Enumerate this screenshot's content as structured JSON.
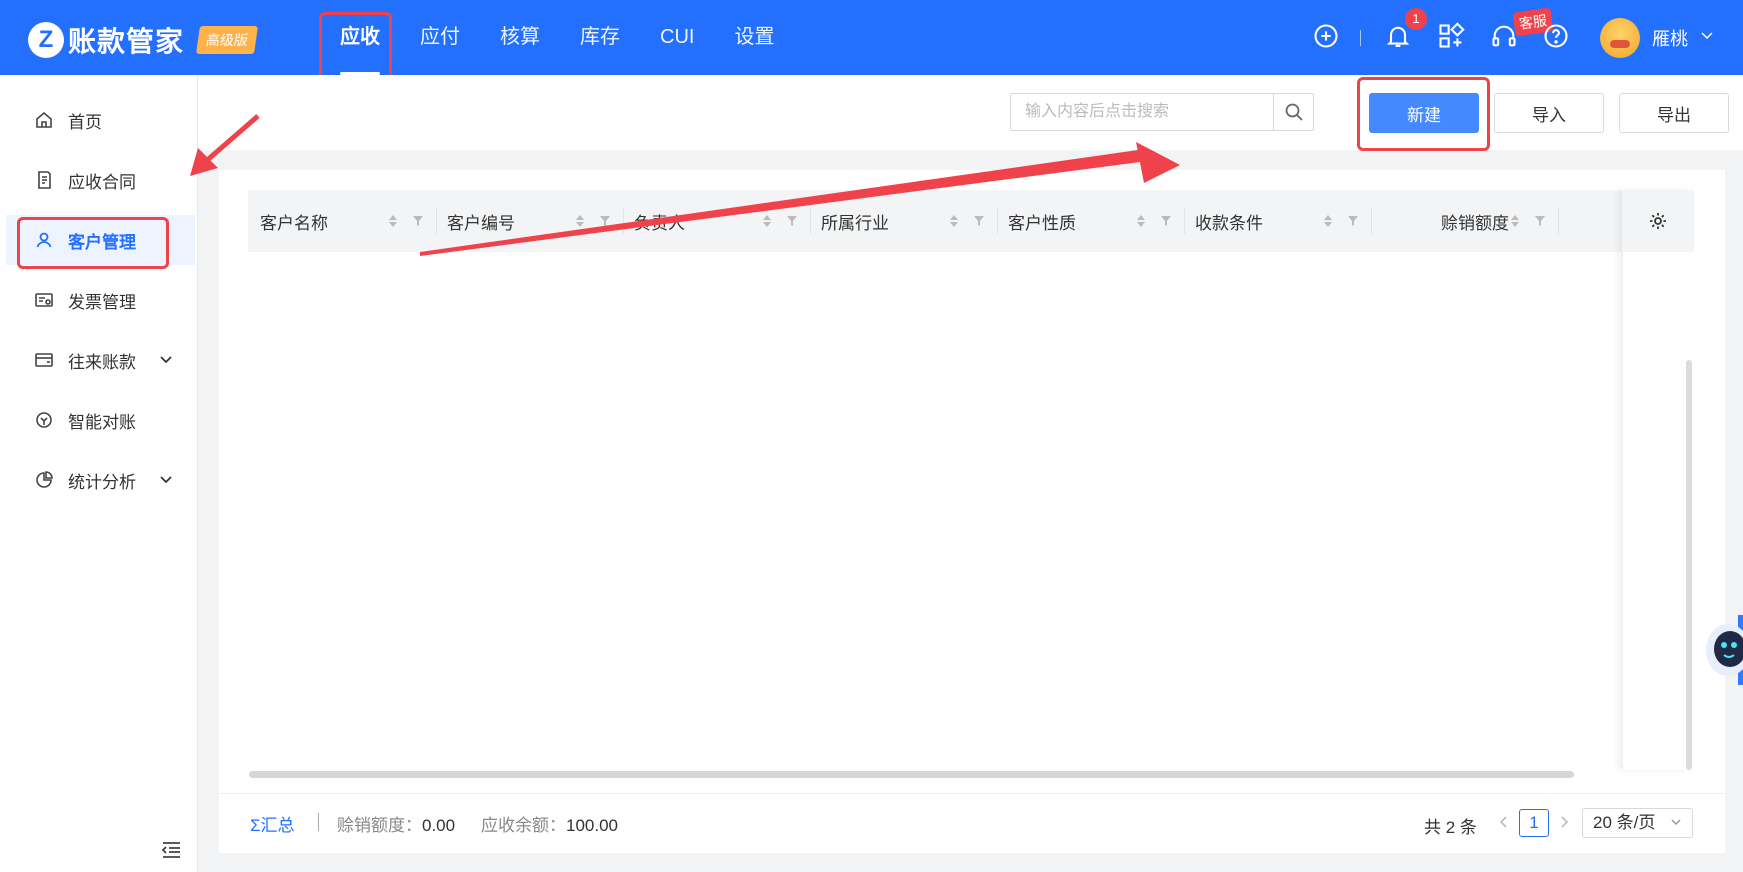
{
  "app": {
    "logo_mark": "Z",
    "name": "账款管家",
    "edition_badge": "高级版"
  },
  "nav": {
    "items": [
      "应收",
      "应付",
      "核算",
      "库存",
      "CUI",
      "设置"
    ],
    "active_index": 0
  },
  "header": {
    "notification_count": "1",
    "service_tag": "客服",
    "user_name": "雁桃",
    "icons": [
      "plus-circle-icon",
      "bell-icon",
      "apps-icon",
      "headset-icon",
      "help-icon"
    ]
  },
  "sidebar": {
    "items": [
      {
        "label": "首页",
        "icon": "home-icon"
      },
      {
        "label": "应收合同",
        "icon": "contract-icon"
      },
      {
        "label": "客户管理",
        "icon": "customer-icon",
        "active": true
      },
      {
        "label": "发票管理",
        "icon": "invoice-icon"
      },
      {
        "label": "往来账款",
        "icon": "account-icon",
        "expandable": true
      },
      {
        "label": "智能对账",
        "icon": "reconcile-icon"
      },
      {
        "label": "统计分析",
        "icon": "chart-icon",
        "expandable": true
      }
    ]
  },
  "toolbar": {
    "search_placeholder": "输入内容后点击搜索",
    "new_label": "新建",
    "import_label": "导入",
    "export_label": "导出"
  },
  "table": {
    "columns": [
      "客户名称",
      "客户编号",
      "负责人",
      "所属行业",
      "客户性质",
      "收款条件",
      "赊销额度"
    ]
  },
  "footer": {
    "sum_label": "汇总",
    "sum_symbol": "Σ",
    "credit_label": "赊销额度：",
    "credit_value": "0.00",
    "balance_label": "应收余额：",
    "balance_value": "100.00",
    "total_text": "共 2 条",
    "current_page": "1",
    "page_size": "20 条/页"
  },
  "colors": {
    "primary": "#2370ff",
    "highlight": "#f0424a",
    "badge": "#ffb14a"
  }
}
